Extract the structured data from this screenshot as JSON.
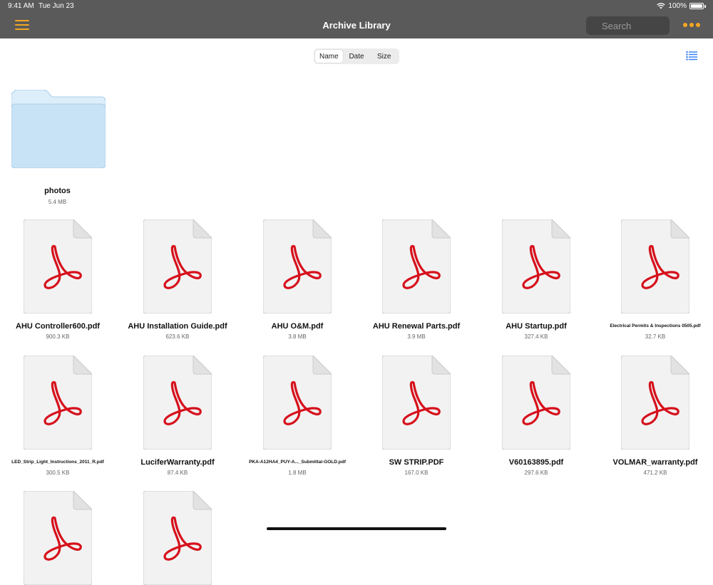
{
  "status_bar": {
    "time": "9:41 AM",
    "date": "Tue Jun 23",
    "battery": "100%"
  },
  "nav": {
    "title": "Archive Library",
    "search_placeholder": "Search"
  },
  "sort": {
    "options": [
      "Name",
      "Date",
      "Size"
    ],
    "selected": "Name"
  },
  "colors": {
    "accent": "#f5a623",
    "navbar": "#5a5a5a",
    "folder": "#cde8f8",
    "pdf_red": "#d6111c"
  },
  "folder": {
    "name": "photos",
    "size": "5.4 MB",
    "icon": "folder-icon"
  },
  "files": [
    {
      "name": "AHU Controller600.pdf",
      "size": "900.3 KB",
      "icon": "pdf-icon"
    },
    {
      "name": "AHU Installation Guide.pdf",
      "size": "623.6 KB",
      "icon": "pdf-icon"
    },
    {
      "name": "AHU O&M.pdf",
      "size": "3.8 MB",
      "icon": "pdf-icon"
    },
    {
      "name": "AHU Renewal Parts.pdf",
      "size": "3.9 MB",
      "icon": "pdf-icon"
    },
    {
      "name": "AHU Startup.pdf",
      "size": "327.4 KB",
      "icon": "pdf-icon"
    },
    {
      "name": "Electrical Permits & Inspections 0505.pdf",
      "size": "32.7 KB",
      "icon": "pdf-icon"
    },
    {
      "name": "LED_Strip_Light_Instructions_2011_R.pdf",
      "size": "300.5 KB",
      "icon": "pdf-icon"
    },
    {
      "name": "LuciferWarranty.pdf",
      "size": "87.4 KB",
      "icon": "pdf-icon"
    },
    {
      "name": "PKA-A12HA4_PUY-A..._Submittal-GOLD.pdf",
      "size": "1.8 MB",
      "icon": "pdf-icon"
    },
    {
      "name": "SW STRIP.PDF",
      "size": "167.0 KB",
      "icon": "pdf-icon"
    },
    {
      "name": "V60163895.pdf",
      "size": "297.6 KB",
      "icon": "pdf-icon"
    },
    {
      "name": "VOLMAR_warranty.pdf",
      "size": "471.2 KB",
      "icon": "pdf-icon"
    },
    {
      "name": "",
      "size": "",
      "icon": "pdf-icon"
    },
    {
      "name": "",
      "size": "",
      "icon": "pdf-icon"
    }
  ]
}
